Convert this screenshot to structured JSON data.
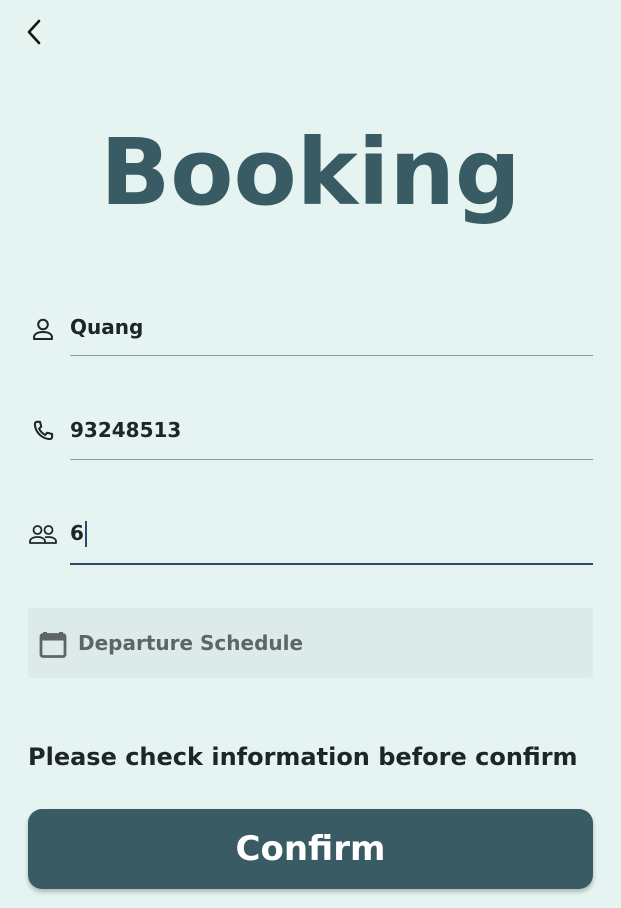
{
  "header": {
    "back_icon": "chevron-left-icon",
    "title": "Booking"
  },
  "form": {
    "name": {
      "icon": "person-icon",
      "value": "Quang"
    },
    "phone": {
      "icon": "phone-icon",
      "value": "93248513"
    },
    "guests": {
      "icon": "group-icon",
      "value": "6",
      "focused": true
    },
    "schedule": {
      "icon": "calendar-icon",
      "label": "Departure Schedule"
    }
  },
  "notice": "Please check information before confirm",
  "confirm_label": "Confirm",
  "colors": {
    "background": "#e5f4f1",
    "primary": "#385b64",
    "focus_underline": "#2a4a6b",
    "schedule_bg": "#dcebe7"
  }
}
